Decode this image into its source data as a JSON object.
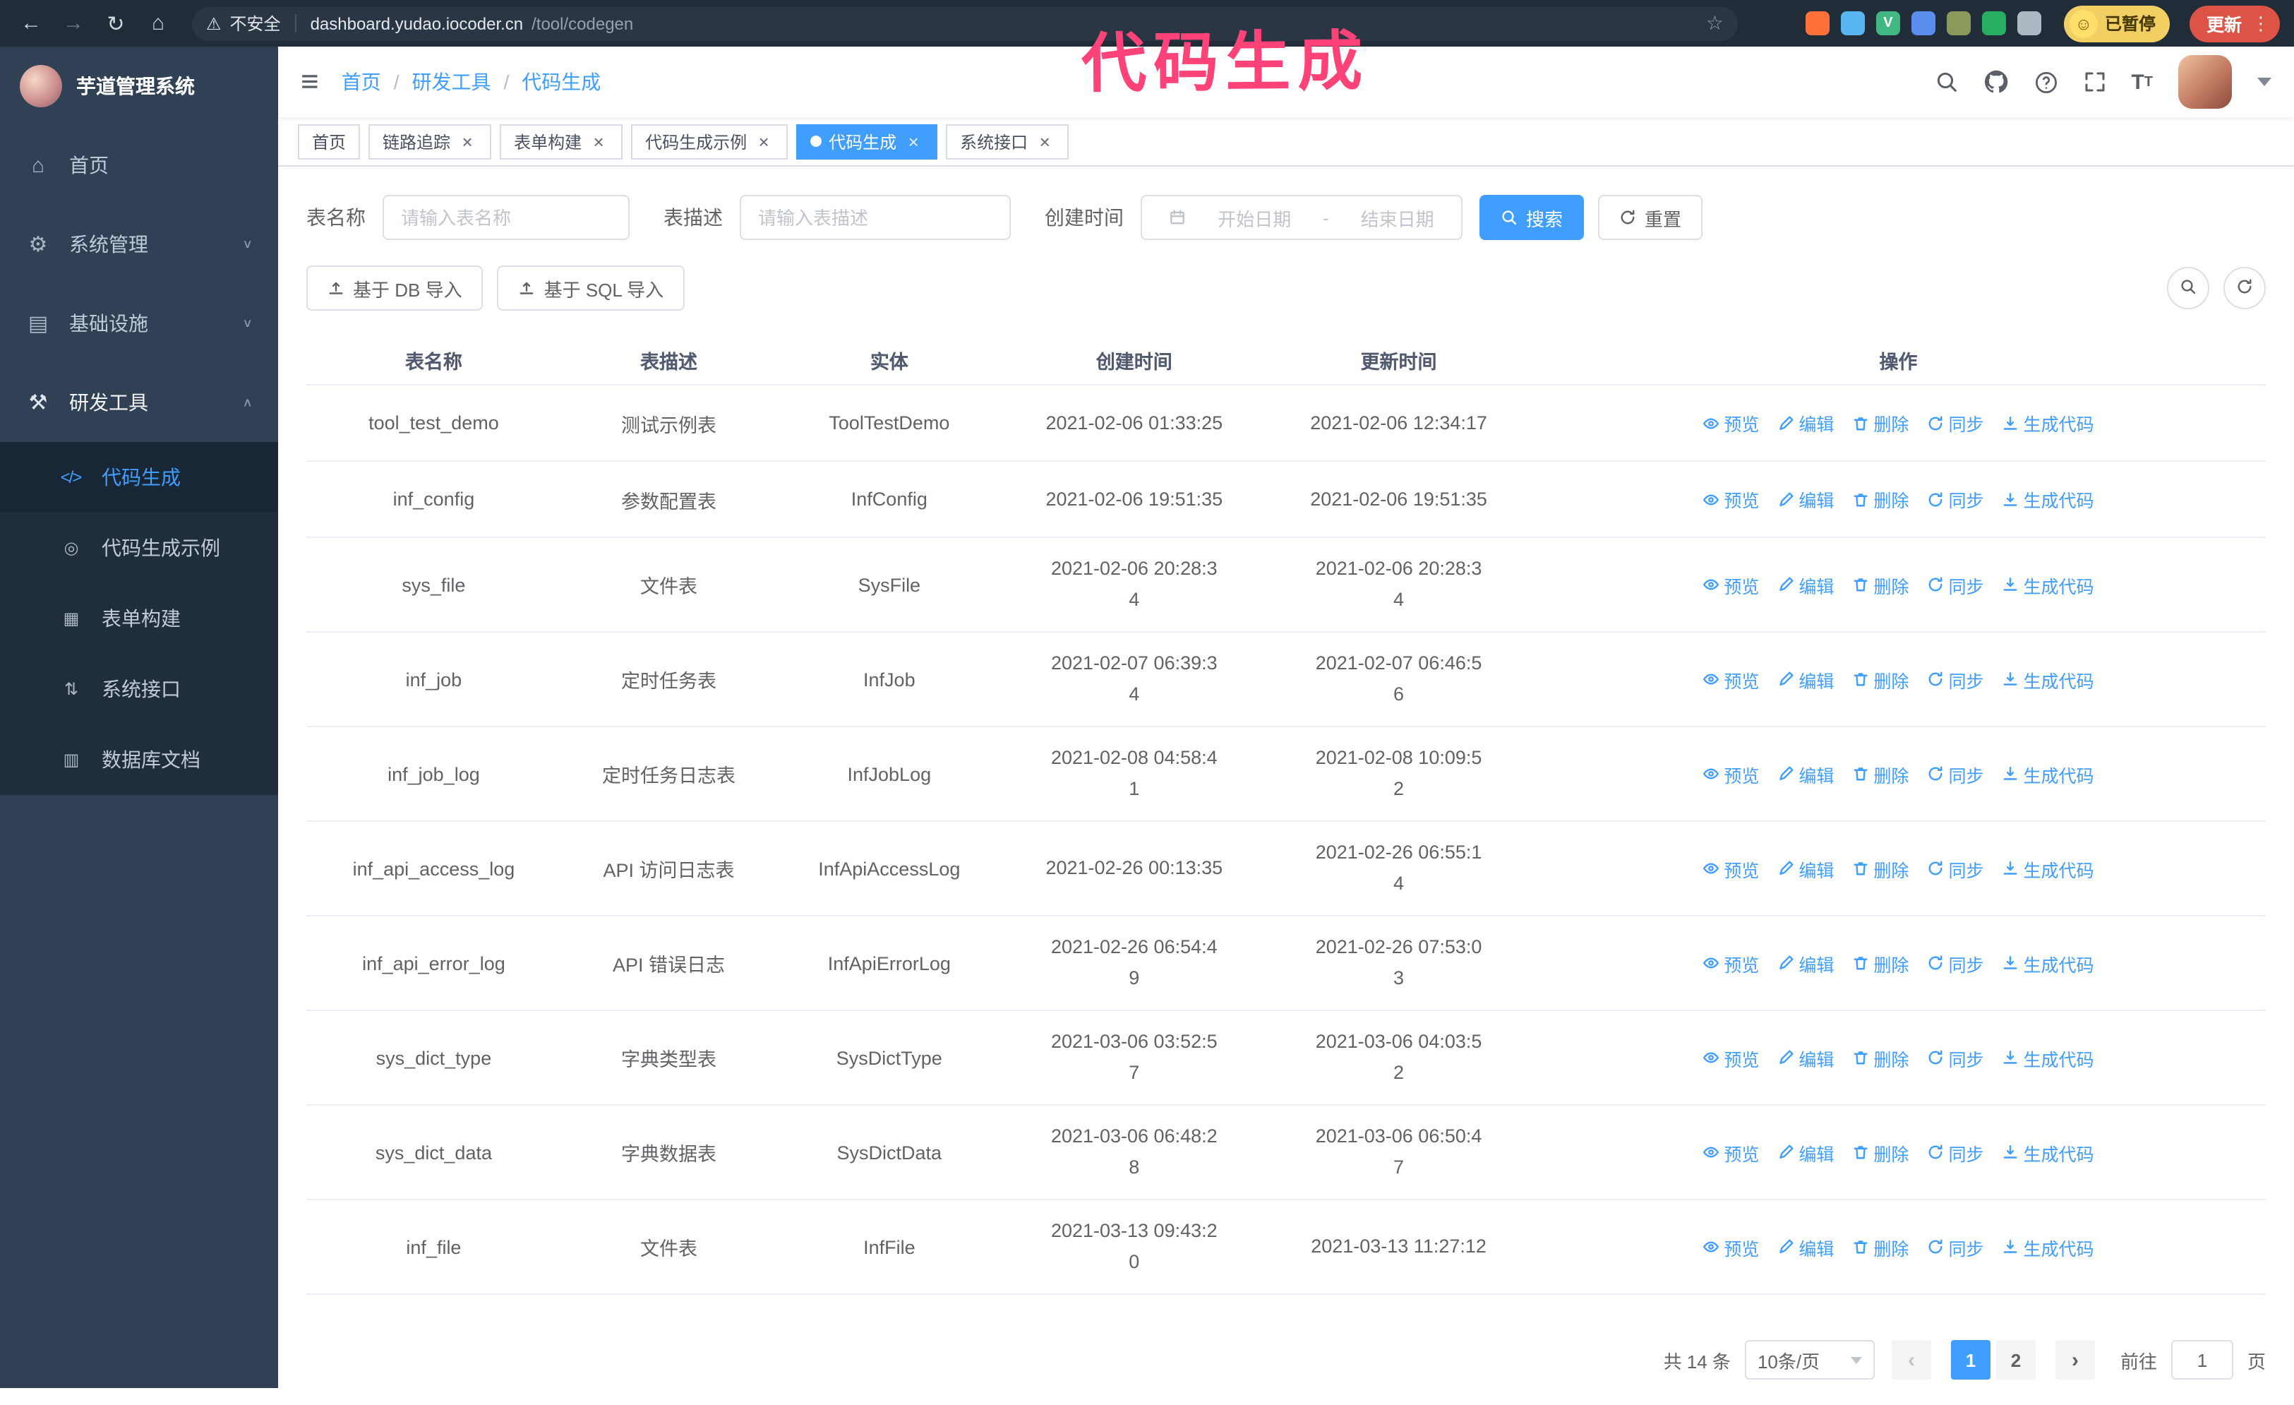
{
  "annotation": {
    "text": "代码生成",
    "color": "#ff4277"
  },
  "theme": {
    "accent": "#409eff",
    "sidebar_bg": "#304156",
    "submenu_bg": "#1f2d3d",
    "chrome_bg": "#212c39",
    "update_red": "#dd5345",
    "paused_yellow": "#f1cf63",
    "table_border": "#ebeef5",
    "link": "#409eff"
  },
  "browser": {
    "insecure_label": "不安全",
    "url_host": "dashboard.yudao.iocoder.cn",
    "url_path": "/tool/codegen",
    "paused_badge": "已暂停",
    "update_button": "更新",
    "extensions": [
      {
        "name": "extension-orange-icon",
        "color": "#ff7139",
        "glyph": ""
      },
      {
        "name": "extension-blue-drop-icon",
        "color": "#58b5f0",
        "glyph": ""
      },
      {
        "name": "extension-vue-devtools-icon",
        "color": "#41b883",
        "glyph": "V"
      },
      {
        "name": "extension-people-icon",
        "color": "#5b8def",
        "glyph": ""
      },
      {
        "name": "extension-proxy-icon",
        "color": "#8a9a5b",
        "glyph": ""
      },
      {
        "name": "extension-green-icon",
        "color": "#27ae60",
        "glyph": ""
      },
      {
        "name": "extension-puzzle-icon",
        "color": "#aeb8c2",
        "glyph": ""
      }
    ]
  },
  "sidebar": {
    "app_title": "芋道管理系统",
    "items": [
      {
        "id": "home",
        "label": "首页",
        "icon": "home-icon"
      },
      {
        "id": "system-management",
        "label": "系统管理",
        "icon": "gear-icon",
        "chevron": "down"
      },
      {
        "id": "infrastructure",
        "label": "基础设施",
        "icon": "infrastructure-icon",
        "chevron": "down"
      },
      {
        "id": "dev-tools",
        "label": "研发工具",
        "icon": "dev-tools-icon",
        "chevron": "up",
        "expanded": true,
        "children": [
          {
            "id": "codegen",
            "label": "代码生成",
            "icon": "code-icon",
            "active": true
          },
          {
            "id": "codegen-example",
            "label": "代码生成示例",
            "icon": "code-example-icon"
          },
          {
            "id": "form-builder",
            "label": "表单构建",
            "icon": "form-builder-icon"
          },
          {
            "id": "api",
            "label": "系统接口",
            "icon": "api-icon"
          },
          {
            "id": "database-doc",
            "label": "数据库文档",
            "icon": "database-doc-icon"
          }
        ]
      }
    ]
  },
  "navbar": {
    "breadcrumb": [
      "首页",
      "研发工具",
      "代码生成"
    ]
  },
  "tabs": [
    {
      "id": "home",
      "label": "首页",
      "closable": false,
      "active": false
    },
    {
      "id": "tracing",
      "label": "链路追踪",
      "closable": true,
      "active": false
    },
    {
      "id": "form-builder",
      "label": "表单构建",
      "closable": true,
      "active": false
    },
    {
      "id": "codegen-example",
      "label": "代码生成示例",
      "closable": true,
      "active": false
    },
    {
      "id": "codegen",
      "label": "代码生成",
      "closable": true,
      "active": true
    },
    {
      "id": "api",
      "label": "系统接口",
      "closable": true,
      "active": false
    }
  ],
  "filters": {
    "table_name_label": "表名称",
    "table_name_placeholder": "请输入表名称",
    "table_desc_label": "表描述",
    "table_desc_placeholder": "请输入表描述",
    "create_time_label": "创建时间",
    "start_placeholder": "开始日期",
    "range_separator": "-",
    "end_placeholder": "结束日期",
    "search_button": "搜索",
    "reset_button": "重置"
  },
  "toolbar": {
    "import_db_label": "基于 DB 导入",
    "import_sql_label": "基于 SQL 导入"
  },
  "table": {
    "columns": [
      "表名称",
      "表描述",
      "实体",
      "创建时间",
      "更新时间",
      "操作"
    ],
    "operations": [
      {
        "id": "preview",
        "label": "预览",
        "icon": "eye-icon"
      },
      {
        "id": "edit",
        "label": "编辑",
        "icon": "edit-icon"
      },
      {
        "id": "delete",
        "label": "删除",
        "icon": "delete-icon"
      },
      {
        "id": "sync",
        "label": "同步",
        "icon": "sync-icon"
      },
      {
        "id": "generate",
        "label": "生成代码",
        "icon": "generate-code-icon"
      }
    ],
    "rows": [
      {
        "name": "tool_test_demo",
        "desc": "测试示例表",
        "entity": "ToolTestDemo",
        "created": "2021-02-06 01:33:25",
        "updated": "2021-02-06 12:34:17"
      },
      {
        "name": "inf_config",
        "desc": "参数配置表",
        "entity": "InfConfig",
        "created": "2021-02-06 19:51:35",
        "updated": "2021-02-06 19:51:35"
      },
      {
        "name": "sys_file",
        "desc": "文件表",
        "entity": "SysFile",
        "created": "2021-02-06 20:28:3\n4",
        "updated": "2021-02-06 20:28:3\n4"
      },
      {
        "name": "inf_job",
        "desc": "定时任务表",
        "entity": "InfJob",
        "created": "2021-02-07 06:39:3\n4",
        "updated": "2021-02-07 06:46:5\n6"
      },
      {
        "name": "inf_job_log",
        "desc": "定时任务日志表",
        "entity": "InfJobLog",
        "created": "2021-02-08 04:58:4\n1",
        "updated": "2021-02-08 10:09:5\n2"
      },
      {
        "name": "inf_api_access_log",
        "desc": "API 访问日志表",
        "entity": "InfApiAccessLog",
        "created": "2021-02-26 00:13:35",
        "updated": "2021-02-26 06:55:1\n4"
      },
      {
        "name": "inf_api_error_log",
        "desc": "API 错误日志",
        "entity": "InfApiErrorLog",
        "created": "2021-02-26 06:54:4\n9",
        "updated": "2021-02-26 07:53:0\n3"
      },
      {
        "name": "sys_dict_type",
        "desc": "字典类型表",
        "entity": "SysDictType",
        "created": "2021-03-06 03:52:5\n7",
        "updated": "2021-03-06 04:03:5\n2"
      },
      {
        "name": "sys_dict_data",
        "desc": "字典数据表",
        "entity": "SysDictData",
        "created": "2021-03-06 06:48:2\n8",
        "updated": "2021-03-06 06:50:4\n7"
      },
      {
        "name": "inf_file",
        "desc": "文件表",
        "entity": "InfFile",
        "created": "2021-03-13 09:43:2\n0",
        "updated": "2021-03-13 11:27:12"
      }
    ]
  },
  "pagination": {
    "total_text": "共 14 条",
    "page_size_text": "10条/页",
    "pages": [
      "1",
      "2"
    ],
    "active_page": "1",
    "goto_label": "前往",
    "goto_value": "1",
    "unit_label": "页"
  }
}
